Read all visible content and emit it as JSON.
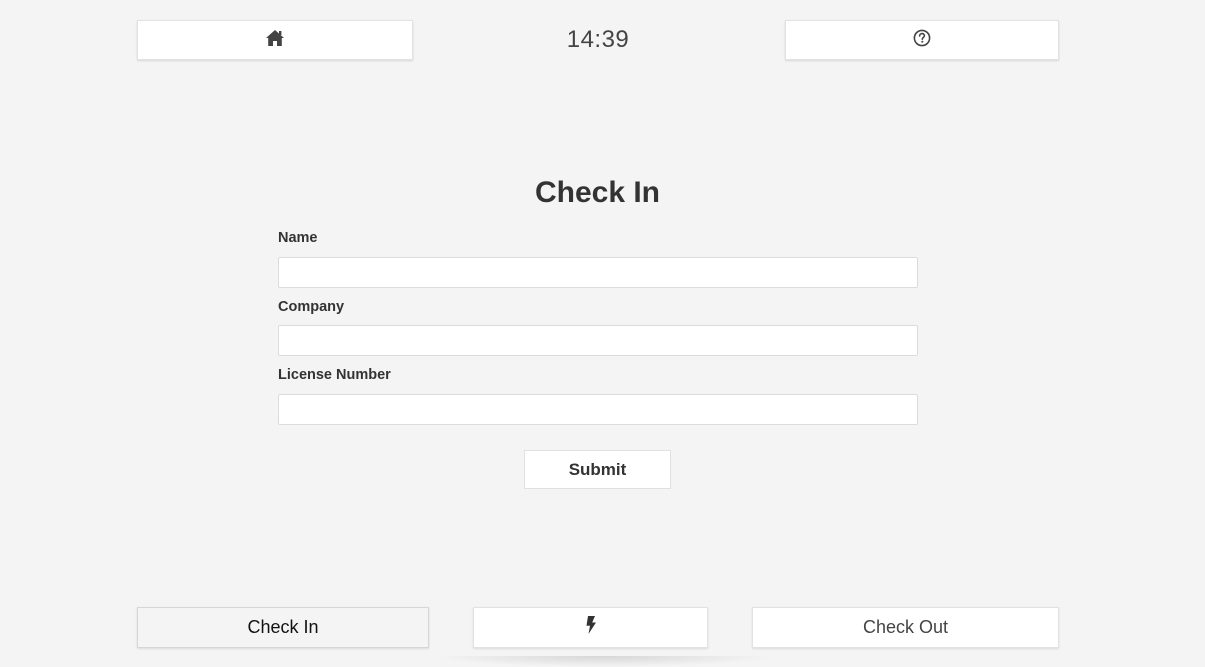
{
  "header": {
    "home_icon": "home-icon",
    "clock": "14:39",
    "help_icon": "question-circle-icon"
  },
  "form": {
    "title": "Check In",
    "fields": [
      {
        "label": "Name",
        "value": "",
        "placeholder": ""
      },
      {
        "label": "Company",
        "value": "",
        "placeholder": ""
      },
      {
        "label": "License Number",
        "value": "",
        "placeholder": ""
      }
    ],
    "submit_label": "Submit"
  },
  "footer": {
    "check_in_label": "Check In",
    "flash_icon": "bolt-icon",
    "check_out_label": "Check Out"
  },
  "colors": {
    "background": "#f4f4f4",
    "button_bg": "#ffffff",
    "active_tab_bg": "#f4f4f4",
    "text": "#333333"
  }
}
